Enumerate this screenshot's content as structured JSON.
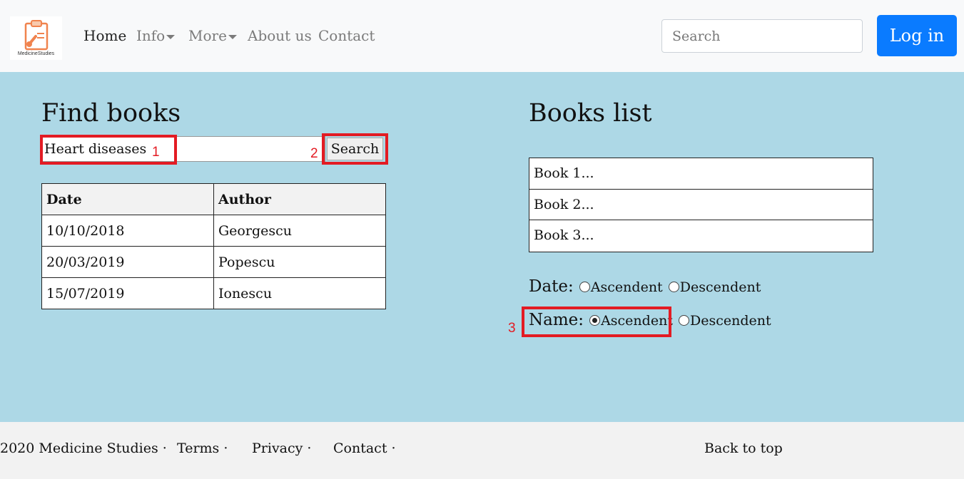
{
  "nav": {
    "logo_text": "MedicineStudies",
    "links": [
      {
        "label": "Home"
      },
      {
        "label": "Info"
      },
      {
        "label": "More"
      },
      {
        "label": "About us"
      },
      {
        "label": "Contact"
      }
    ],
    "search_placeholder": "Search",
    "login_label": "Log in"
  },
  "find": {
    "title": "Find books",
    "query": "Heart diseases",
    "search_label": "Search",
    "table": {
      "headers": [
        "Date",
        "Author"
      ],
      "rows": [
        [
          "10/10/2018",
          "Georgescu"
        ],
        [
          "20/03/2019",
          "Popescu"
        ],
        [
          "15/07/2019",
          "Ionescu"
        ]
      ]
    }
  },
  "list": {
    "title": "Books list",
    "items": [
      "Book 1...",
      "Book 2...",
      "Book 3..."
    ],
    "date_label": "Date:",
    "name_label": "Name:",
    "asc_label": "Ascendent",
    "desc_label": "Descendent"
  },
  "annotations": [
    "1",
    "2",
    "3"
  ],
  "footer": {
    "copyright": "2020 Medicine Studies ·",
    "terms": "Terms ·",
    "privacy": "Privacy ·",
    "contact": "Contact ·",
    "back_to_top": "Back to top"
  },
  "colors": {
    "background": "#add8e6",
    "navbar": "#f8f9fa",
    "primary": "#0a7bff",
    "highlight": "#e31b23"
  }
}
